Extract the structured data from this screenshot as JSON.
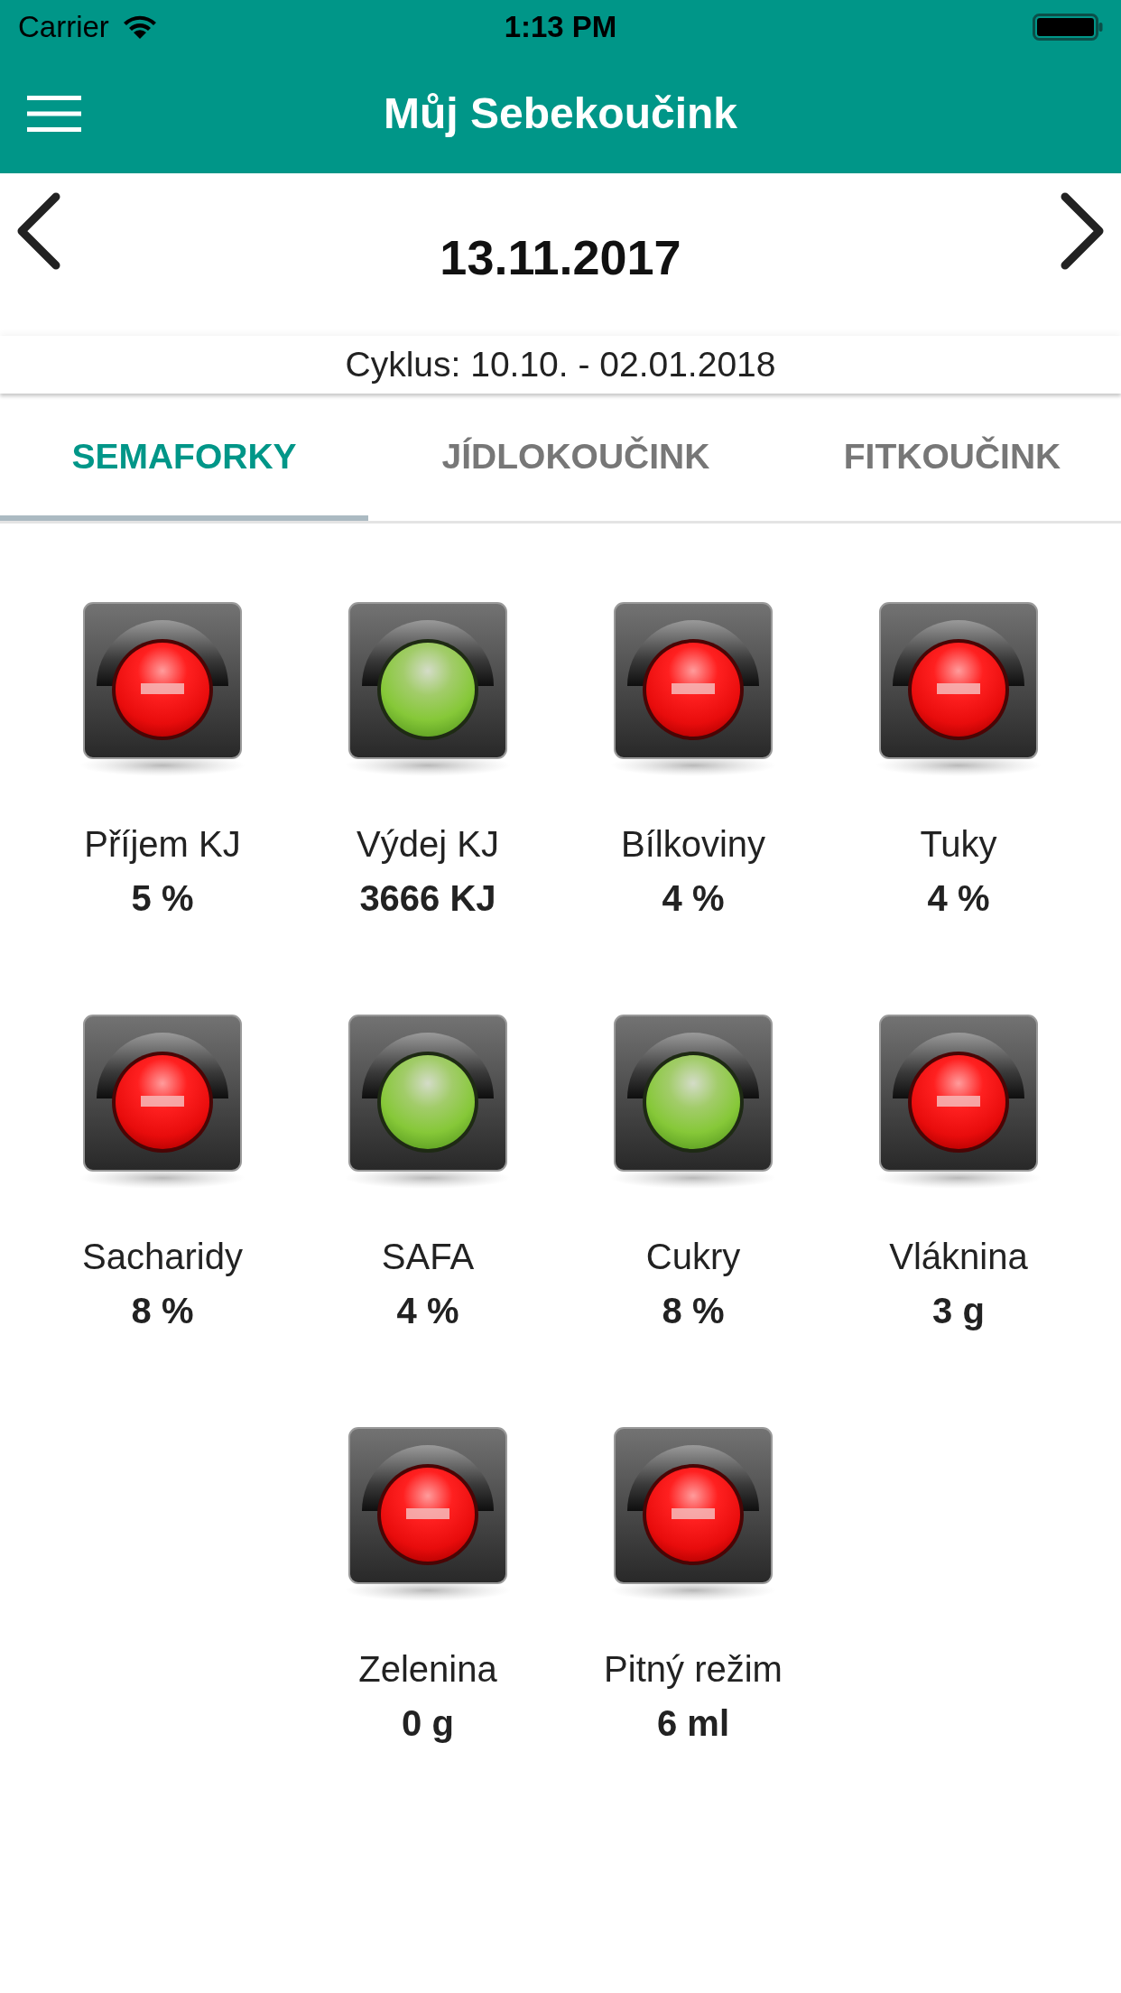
{
  "status_bar": {
    "carrier": "Carrier",
    "time": "1:13 PM"
  },
  "app_bar": {
    "title": "Můj Sebekoučink"
  },
  "date_nav": {
    "date": "13.11.2017"
  },
  "cycle": {
    "text": "Cyklus: 10.10. - 02.01.2018"
  },
  "tabs": [
    {
      "label": "SEMAFORKY",
      "selected": true
    },
    {
      "label": "JÍDLOKOUČINK",
      "selected": false
    },
    {
      "label": "FITKOUČINK",
      "selected": false
    }
  ],
  "indicators": [
    {
      "label": "Příjem KJ",
      "value": "5 %",
      "ok": false
    },
    {
      "label": "Výdej KJ",
      "value": "3666 KJ",
      "ok": true
    },
    {
      "label": "Bílkoviny",
      "value": "4 %",
      "ok": false
    },
    {
      "label": "Tuky",
      "value": "4 %",
      "ok": false
    },
    {
      "label": "Sacharidy",
      "value": "8 %",
      "ok": false
    },
    {
      "label": "SAFA",
      "value": "4 %",
      "ok": true
    },
    {
      "label": "Cukry",
      "value": "8 %",
      "ok": true
    },
    {
      "label": "Vláknina",
      "value": "3 g",
      "ok": false
    },
    {
      "label": "Zelenina",
      "value": "0 g",
      "ok": false
    },
    {
      "label": "Pitný režim",
      "value": "6 ml",
      "ok": false
    }
  ]
}
